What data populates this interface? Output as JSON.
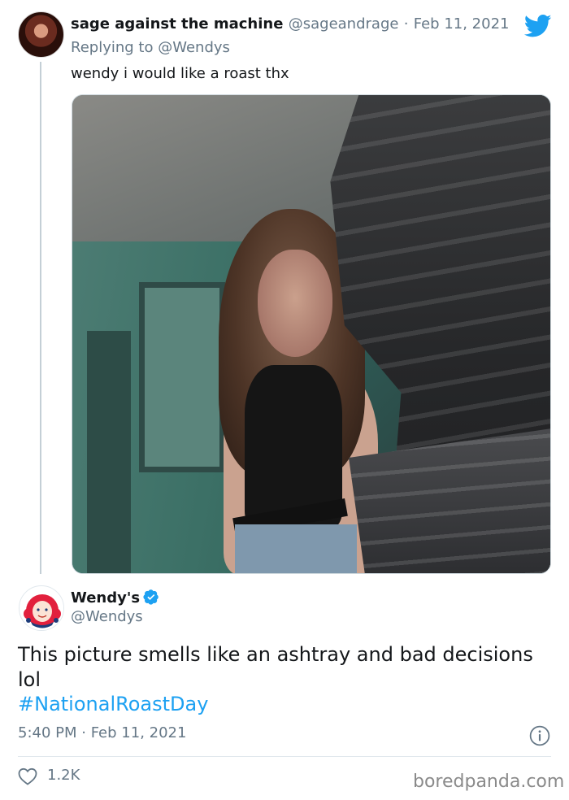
{
  "reply_tweet": {
    "display_name": "sage against the machine",
    "handle": "@sageandrage",
    "separator": "·",
    "date": "Feb 11, 2021",
    "replying_label": "Replying to",
    "replying_mention": "@Wendys",
    "text": "wendy i would like a roast thx",
    "photo_icon": "photo"
  },
  "wendys_tweet": {
    "display_name": "Wendy's",
    "handle": "@Wendys",
    "text": "This picture smells like an ashtray and bad decisions lol",
    "hashtag": "#NationalRoastDay",
    "timestamp": "5:40 PM · Feb 11, 2021",
    "likes": "1.2K"
  },
  "icons": {
    "platform": "twitter-bird-icon",
    "verified": "verified-badge-icon",
    "info": "info-icon",
    "like": "heart-icon"
  },
  "colors": {
    "link_blue": "#1da1f2",
    "muted_gray": "#657786",
    "wendys_red": "#e2203d"
  },
  "watermark": "boredpanda.com"
}
